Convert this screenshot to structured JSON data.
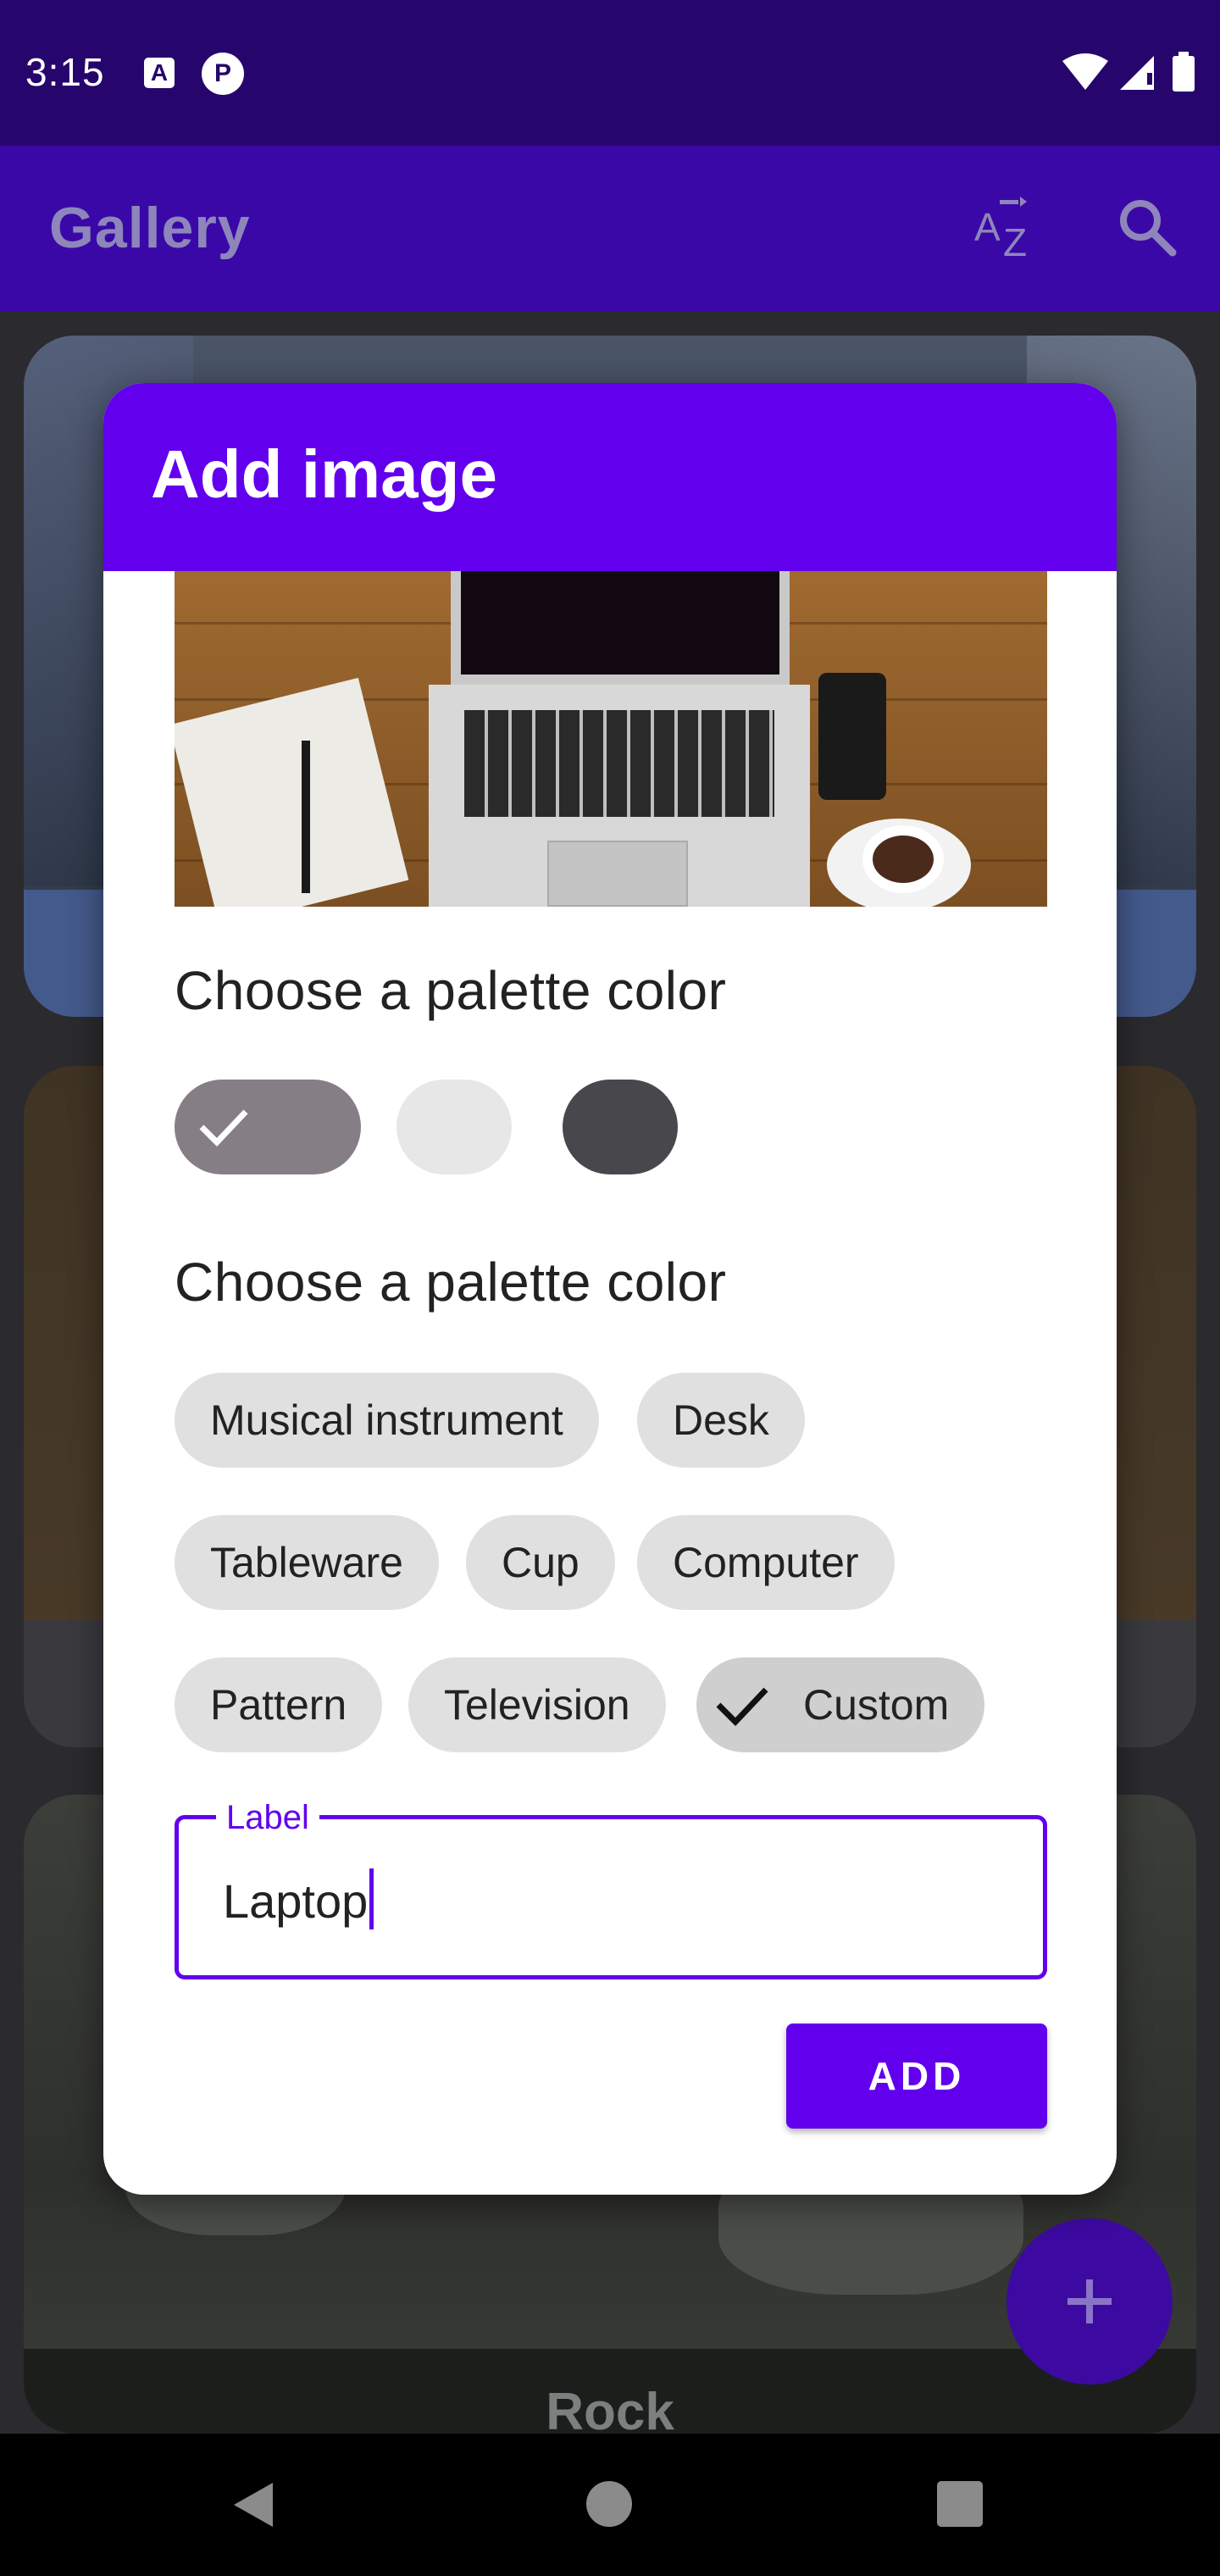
{
  "status_bar": {
    "time": "3:15",
    "left_icons": [
      "text-a-icon",
      "app-notification-icon"
    ],
    "right_icons": [
      "wifi-icon",
      "cell-signal-icon",
      "battery-icon"
    ]
  },
  "app_bar": {
    "title": "Gallery",
    "actions": [
      "sort-az-icon",
      "search-icon"
    ]
  },
  "gallery": {
    "cards": [
      {
        "label": ""
      },
      {
        "label": ""
      },
      {
        "label": "Rock"
      }
    ],
    "fab_icon": "plus-icon"
  },
  "dialog": {
    "title": "Add image",
    "palette_heading": "Choose a palette color",
    "palette_swatches": [
      {
        "color": "#857f85",
        "selected": true
      },
      {
        "color": "#e8e7e8",
        "selected": false
      },
      {
        "color": "#48474c",
        "selected": false
      }
    ],
    "label_heading": "Choose a palette color",
    "chips": [
      {
        "label": "Musical instrument",
        "selected": false
      },
      {
        "label": "Desk",
        "selected": false
      },
      {
        "label": "Tableware",
        "selected": false
      },
      {
        "label": "Cup",
        "selected": false
      },
      {
        "label": "Computer",
        "selected": false
      },
      {
        "label": "Pattern",
        "selected": false
      },
      {
        "label": "Television",
        "selected": false
      },
      {
        "label": "Custom",
        "selected": true
      }
    ],
    "label_field": {
      "label": "Label",
      "value": "Laptop"
    },
    "add_button": "ADD"
  },
  "colors": {
    "primary": "#6200ee",
    "status_bar": "#26066c",
    "app_bar_dimmed": "#3b08a8",
    "chip": "#e0e0e0"
  }
}
